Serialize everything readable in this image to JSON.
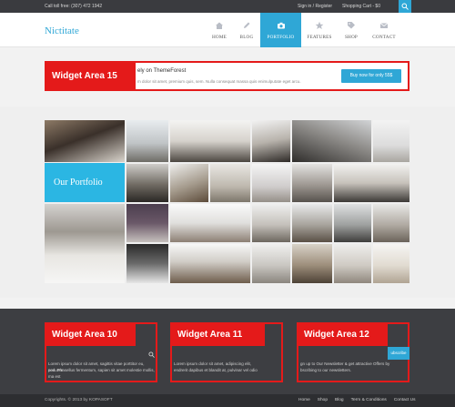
{
  "topbar": {
    "phone": "Call toll free: (307) 472 1942",
    "signin": "Sign in / Register",
    "cart": "Shopping Cart - $0"
  },
  "header": {
    "logo": "Nictitate",
    "nav": [
      {
        "label": "HOME",
        "icon": "home-icon"
      },
      {
        "label": "BLOG",
        "icon": "pencil-icon"
      },
      {
        "label": "PORTFOLIO",
        "icon": "camera-icon",
        "active": true
      },
      {
        "label": "FEATURES",
        "icon": "star-icon"
      },
      {
        "label": "SHOP",
        "icon": "tag-icon"
      },
      {
        "label": "CONTACT",
        "icon": "envelope-icon"
      }
    ]
  },
  "banner": {
    "tag": "Widget Area 15",
    "headline": "ely on ThemeForest",
    "sub": "m dolor sit amet, premium quis, sem. Nulla consequat massa quis enimulputate eget arcu.",
    "button": "Buy now for only 55$"
  },
  "portfolio": {
    "title": "Our Portfolio"
  },
  "widgets": [
    {
      "tag": "Widget Area 10",
      "lines": [
        "Lorem ipsum dolor sit amet, sagittis vitae porttitor eu, posuere",
        "sed. Phasellus fermentum, sapien sit amet molestie mollis,",
        "ma est"
      ]
    },
    {
      "tag": "Widget Area 11",
      "lines": [
        "Lorem ipsum dolor sit amet, adipiscing elit,",
        "endrerit dapibus et blandit at, pulvinar vel odio"
      ]
    },
    {
      "tag": "Widget Area 12",
      "lines": [
        "gn up to Our Newsletter & get attractive Offers by",
        "bscribing to our newsletters."
      ],
      "button": "ubscribe"
    }
  ],
  "footer": {
    "copyright": "Copyrights. © 2013 by KOPASOFT",
    "links": [
      "Home",
      "Shop",
      "Blog",
      "Term & Conditions",
      "Contact Us"
    ]
  },
  "colors": {
    "accent": "#2fa7d6",
    "widget_marker": "#e41a1a",
    "dark": "#3d3e42"
  }
}
